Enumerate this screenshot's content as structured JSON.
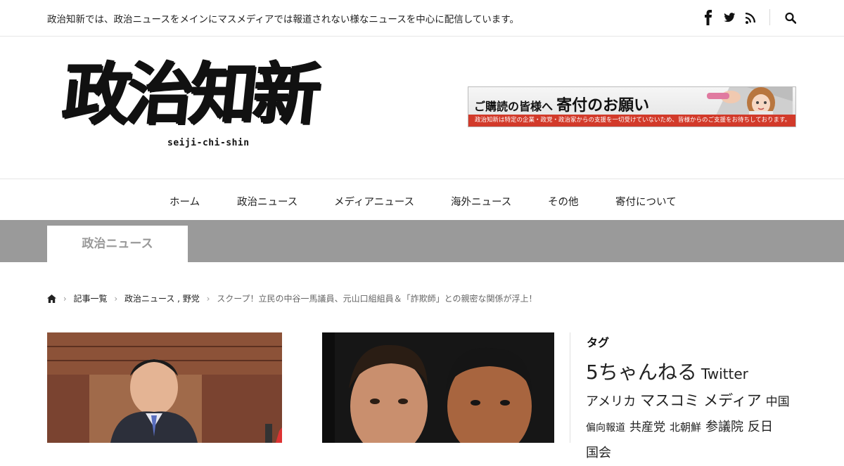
{
  "header": {
    "tagline": "政治知新では、政治ニュースをメインにマスメディアでは報道されない様なニュースを中心に配信しています。"
  },
  "social": {
    "icons": [
      "facebook-icon",
      "twitter-icon",
      "rss-icon",
      "search-icon"
    ]
  },
  "logo": {
    "title": "政治知新",
    "subtitle": "seiji-chi-shin"
  },
  "banner": {
    "headline_small": "ご購読の皆様へ",
    "headline_big": "寄付のお願い",
    "subline": "政治知新は特定の企業・政党・政治家からの支援を一切受けていないため、皆様からのご支援をお待ちしております。"
  },
  "nav": {
    "items": [
      "ホーム",
      "政治ニュース",
      "メディアニュース",
      "海外ニュース",
      "その他",
      "寄付について"
    ]
  },
  "category": {
    "tab_label": "政治ニュース"
  },
  "breadcrumb": {
    "items": [
      "記事一覧",
      "政治ニュース , 野党",
      "スクープ！立民の中谷一馬議員、元山口組組員＆「詐欺師」との親密な関係が浮上！"
    ]
  },
  "sidebar": {
    "tag_heading": "タグ",
    "tags": [
      "5ちゃんねる",
      "Twitter",
      "アメリカ",
      "マスコミ",
      "メディア",
      "中国",
      "偏向報道",
      "共産党",
      "北朝鮮",
      "参議院",
      "反日",
      "国会"
    ]
  }
}
